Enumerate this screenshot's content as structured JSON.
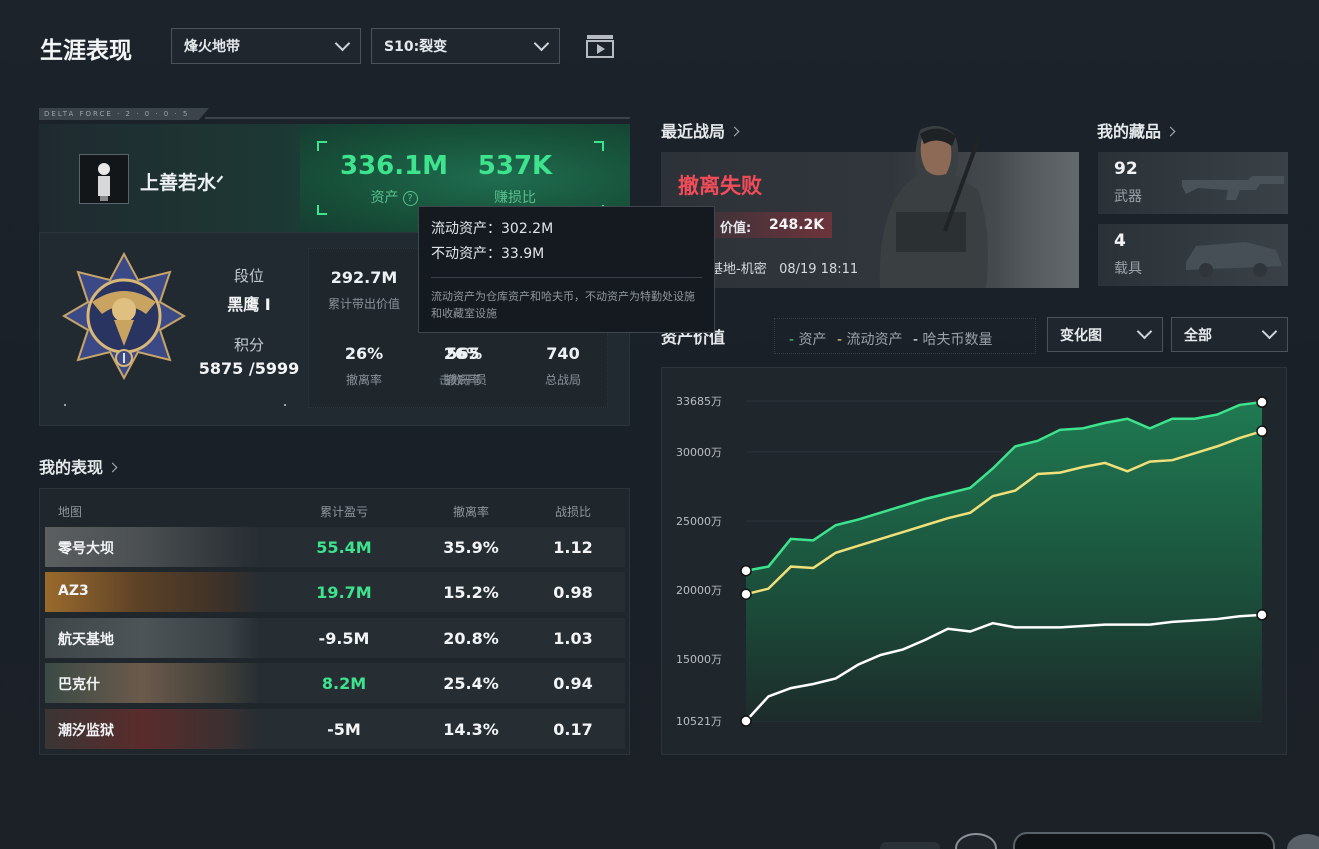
{
  "header": {
    "title": "生涯表现",
    "mode_select": "烽火地带",
    "season_select": "S10:裂变"
  },
  "profile": {
    "brand_strip": "DELTA FORCE · 2 · 0 · 0 · 5",
    "player_name": "上善若水ᐟ",
    "assets_value": "336.1M",
    "assets_label": "资产",
    "ratio_value": "537K",
    "ratio_label": "赚损比",
    "rank_label": "段位",
    "rank_value": "黑鹰 I",
    "score_label": "积分",
    "score_value": "5875 /5999",
    "stats": [
      {
        "value": "292.7M",
        "label": "累计带出价值"
      },
      {
        "value": "",
        "label": ""
      },
      {
        "value": "",
        "label": ""
      },
      {
        "value": "26%",
        "label": "撤离率"
      },
      {
        "value": "565",
        "label": "击败干员"
      },
      {
        "value": "740",
        "label": "总战局"
      }
    ]
  },
  "tooltip": {
    "liquid": "流动资产：302.2M",
    "fixed": "不动资产：33.9M",
    "note": "流动资产为仓库资产和哈夫币，不动资产为特勤处设施和收藏室设施"
  },
  "performance": {
    "section_title": "我的表现",
    "headers": [
      "地图",
      "累计盈亏",
      "撤离率",
      "战损比"
    ],
    "rows": [
      {
        "map": "零号大坝",
        "profit": "55.4M",
        "rate": "35.9%",
        "kd": "1.12",
        "profit_color": "#3ee38e"
      },
      {
        "map": "AZ3",
        "profit": "19.7M",
        "rate": "15.2%",
        "kd": "0.98",
        "profit_color": "#3ee38e"
      },
      {
        "map": "航天基地",
        "profit": "-9.5M",
        "rate": "20.8%",
        "kd": "1.03",
        "profit_color": "#f2f4f6"
      },
      {
        "map": "巴克什",
        "profit": "8.2M",
        "rate": "25.4%",
        "kd": "0.94",
        "profit_color": "#3ee38e"
      },
      {
        "map": "潮汐监狱",
        "profit": "-5M",
        "rate": "14.3%",
        "kd": "0.17",
        "profit_color": "#f2f4f6"
      }
    ]
  },
  "recent": {
    "section_title": "最近战局",
    "result": "撤离失败",
    "value_label": "价值:",
    "value": "248.2K",
    "map_time": "基地-机密   08/19 18:11"
  },
  "collection": {
    "section_title": "我的藏品",
    "items": [
      {
        "count": "92",
        "label": "武器"
      },
      {
        "count": "4",
        "label": "载具"
      }
    ]
  },
  "asset_chart": {
    "section_title": "资产价值",
    "legend": [
      {
        "name": "资产",
        "color": "#3ee38e"
      },
      {
        "name": "流动资产",
        "color": "#f0e07a"
      },
      {
        "name": "哈夫币数量",
        "color": "#ffffff"
      }
    ],
    "type_select": "变化图",
    "range_select": "全部"
  },
  "chart_data": {
    "type": "line",
    "ylabels": [
      "33685万",
      "30000万",
      "25000万",
      "20000万",
      "15000万",
      "10521万"
    ],
    "ylim": [
      10521,
      33685
    ],
    "series": [
      {
        "name": "资产",
        "color": "#3ee38e",
        "values": [
          21400,
          21700,
          23700,
          23600,
          24700,
          25100,
          25600,
          26100,
          26600,
          27000,
          27400,
          28800,
          30400,
          30800,
          31600,
          31700,
          32100,
          32400,
          31700,
          32400,
          32400,
          32700,
          33400,
          33600
        ]
      },
      {
        "name": "流动资产",
        "color": "#f0e07a",
        "values": [
          19700,
          20100,
          21700,
          21600,
          22700,
          23200,
          23700,
          24200,
          24700,
          25200,
          25600,
          26800,
          27200,
          28400,
          28500,
          28900,
          29200,
          28600,
          29300,
          29400,
          29900,
          30400,
          31000,
          31500
        ]
      },
      {
        "name": "哈夫币数量",
        "color": "#ffffff",
        "values": [
          10521,
          12300,
          12900,
          13200,
          13600,
          14600,
          15300,
          15700,
          16400,
          17200,
          17000,
          17600,
          17300,
          17300,
          17300,
          17400,
          17500,
          17500,
          17500,
          17700,
          17800,
          17900,
          18100,
          18200
        ]
      }
    ]
  }
}
